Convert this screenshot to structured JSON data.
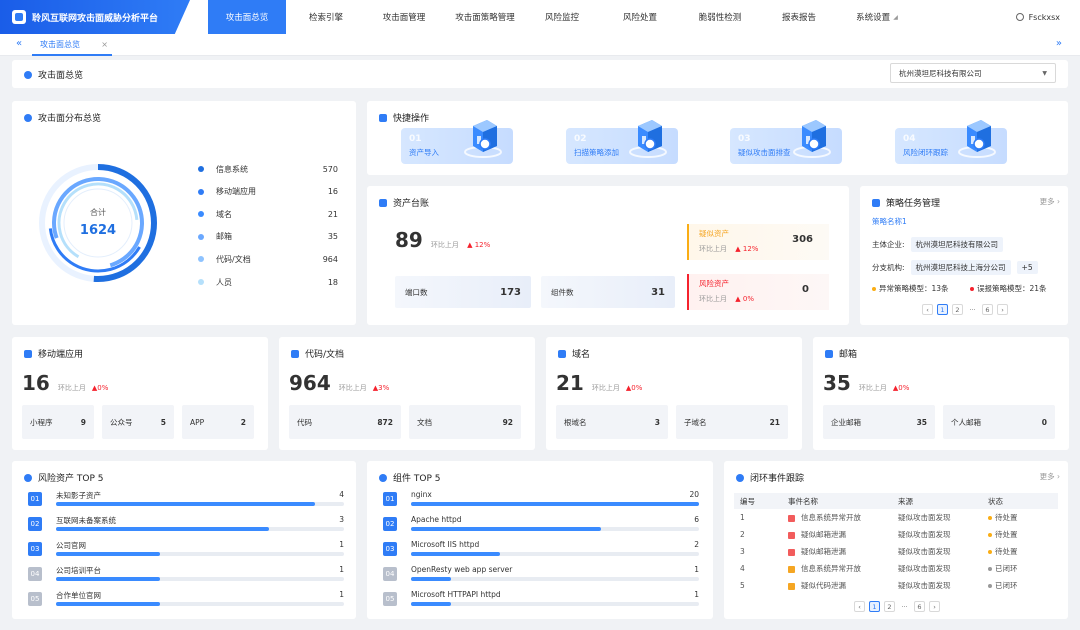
{
  "app": {
    "title": "聆风互联网攻击面威胁分析平台"
  },
  "nav": {
    "items": [
      {
        "label": "攻击面总览"
      },
      {
        "label": "检索引擎"
      },
      {
        "label": "攻击面管理"
      },
      {
        "label": "攻击面策略管理"
      },
      {
        "label": "风险监控"
      },
      {
        "label": "风险处置"
      },
      {
        "label": "脆弱性检测"
      },
      {
        "label": "报表报告"
      },
      {
        "label": "系统设置"
      }
    ],
    "user": "Fsckxsx"
  },
  "tabs": {
    "items": [
      {
        "label": "攻击面总览"
      }
    ]
  },
  "page": {
    "title": "攻击面总览",
    "org_select": "杭州漠坦尼科技有限公司"
  },
  "distribution": {
    "title": "攻击面分布总览",
    "total_label": "合计",
    "total": "1624",
    "items": [
      {
        "label": "信息系统",
        "value": "570",
        "color": "#1f6fe0"
      },
      {
        "label": "移动端应用",
        "value": "16",
        "color": "#2f7cf6"
      },
      {
        "label": "域名",
        "value": "21",
        "color": "#3a8bff"
      },
      {
        "label": "邮箱",
        "value": "35",
        "color": "#6aa8ff"
      },
      {
        "label": "代码/文档",
        "value": "964",
        "color": "#8ec3ff"
      },
      {
        "label": "人员",
        "value": "18",
        "color": "#b5e0fb"
      }
    ]
  },
  "quick": {
    "title": "快捷操作",
    "items": [
      {
        "num": "01",
        "label": "资产导入"
      },
      {
        "num": "02",
        "label": "扫描策略添加"
      },
      {
        "num": "03",
        "label": "疑似攻击面排查"
      },
      {
        "num": "04",
        "label": "风险闭环跟踪"
      }
    ]
  },
  "ledger": {
    "title": "资产台账",
    "total": "89",
    "delta_label": "环比上月",
    "delta": "12%",
    "port_label": "端口数",
    "port": "173",
    "comp_label": "组件数",
    "comp": "31",
    "suspect_label": "疑似资产",
    "suspect_delta": "12%",
    "suspect": "306",
    "risk_label": "风险资产",
    "risk_delta": "0%",
    "risk": "0"
  },
  "policy": {
    "title": "策略任务管理",
    "more": "更多",
    "name": "策略名称1",
    "subject_label": "主体企业:",
    "subject": "杭州漠坦尼科技有限公司",
    "branch_label": "分支机构:",
    "branch": "杭州漠坦尼科技上海分公司",
    "branch_more": "+5",
    "abnormal": "异常策略模型：13条",
    "misreport": "误报策略模型：21条"
  },
  "subcards": [
    {
      "title": "移动端应用",
      "total": "16",
      "delta_label": "环比上月",
      "delta": "0%",
      "boxes": [
        {
          "label": "小程序",
          "value": "9"
        },
        {
          "label": "公众号",
          "value": "5"
        },
        {
          "label": "APP",
          "value": "2"
        }
      ]
    },
    {
      "title": "代码/文档",
      "total": "964",
      "delta_label": "环比上月",
      "delta": "3%",
      "boxes": [
        {
          "label": "代码",
          "value": "872"
        },
        {
          "label": "文档",
          "value": "92"
        }
      ]
    },
    {
      "title": "域名",
      "total": "21",
      "delta_label": "环比上月",
      "delta": "0%",
      "boxes": [
        {
          "label": "根域名",
          "value": "3"
        },
        {
          "label": "子域名",
          "value": "21"
        }
      ]
    },
    {
      "title": "邮箱",
      "total": "35",
      "delta_label": "环比上月",
      "delta": "0%",
      "boxes": [
        {
          "label": "企业邮箱",
          "value": "35"
        },
        {
          "label": "个人邮箱",
          "value": "0"
        }
      ]
    }
  ],
  "risk_top5": {
    "title": "风险资产 TOP 5",
    "items": [
      {
        "rank": "01",
        "name": "未知影子资产",
        "value": "4",
        "fill": 0.9
      },
      {
        "rank": "02",
        "name": "互联网未备案系统",
        "value": "3",
        "fill": 0.74
      },
      {
        "rank": "03",
        "name": "公司官网",
        "value": "1",
        "fill": 0.36
      },
      {
        "rank": "04",
        "name": "公司培训平台",
        "value": "1",
        "fill": 0.36
      },
      {
        "rank": "05",
        "name": "合作单位官网",
        "value": "1",
        "fill": 0.36
      }
    ]
  },
  "comp_top5": {
    "title": "组件 TOP 5",
    "items": [
      {
        "rank": "01",
        "name": "nginx",
        "value": "20",
        "fill": 1.0
      },
      {
        "rank": "02",
        "name": "Apache httpd",
        "value": "6",
        "fill": 0.66
      },
      {
        "rank": "03",
        "name": "Microsoft IIS httpd",
        "value": "2",
        "fill": 0.31
      },
      {
        "rank": "04",
        "name": "OpenResty web app server",
        "value": "1",
        "fill": 0.14
      },
      {
        "rank": "05",
        "name": "Microsoft HTTPAPI httpd",
        "value": "1",
        "fill": 0.14
      }
    ]
  },
  "closed_loop": {
    "title": "闭环事件跟踪",
    "more": "更多",
    "headers": [
      "编号",
      "事件名称",
      "来源",
      "状态"
    ],
    "rows": [
      {
        "no": "1",
        "name": "信息系统异常开放",
        "source": "疑似攻击面发现",
        "status": "待处置",
        "ico": "#f25c5c",
        "dot": "#faad14"
      },
      {
        "no": "2",
        "name": "疑似邮箱泄漏",
        "source": "疑似攻击面发现",
        "status": "待处置",
        "ico": "#f25c5c",
        "dot": "#faad14"
      },
      {
        "no": "3",
        "name": "疑似邮箱泄漏",
        "source": "疑似攻击面发现",
        "status": "待处置",
        "ico": "#f25c5c",
        "dot": "#faad14"
      },
      {
        "no": "4",
        "name": "信息系统异常开放",
        "source": "疑似攻击面发现",
        "status": "已闭环",
        "ico": "#f5a623",
        "dot": "#999999"
      },
      {
        "no": "5",
        "name": "疑似代码泄漏",
        "source": "疑似攻击面发现",
        "status": "已闭环",
        "ico": "#f5a623",
        "dot": "#999999"
      }
    ]
  },
  "pager": {
    "p1": "1",
    "p2": "2",
    "dots": "···",
    "last": "6",
    "prev": "‹",
    "next": "›"
  }
}
